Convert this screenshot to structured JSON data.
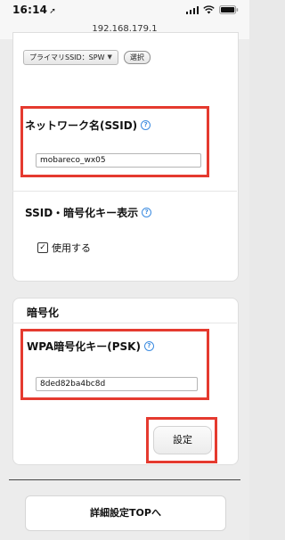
{
  "status_bar": {
    "time": "16:14",
    "location_glyph": "➚",
    "icons": [
      "signal-icon",
      "wifi-icon",
      "battery-icon"
    ]
  },
  "browser": {
    "url": "192.168.179.1"
  },
  "ssid_select": {
    "selected": "プライマリSSID：SPW",
    "select_button": "選択"
  },
  "network_name": {
    "label": "ネットワーク名(SSID)",
    "value": "mobareco_wx05"
  },
  "ssid_key_display": {
    "label": "SSID・暗号化キー表示",
    "checkbox_label": "使用する",
    "checked": true
  },
  "encryption": {
    "section_title": "暗号化",
    "psk_label": "WPA暗号化キー(PSK)",
    "psk_value": "8ded82ba4bc8d"
  },
  "actions": {
    "set_label": "設定",
    "top_link_label": "詳細設定TOPへ"
  },
  "colors": {
    "highlight": "#e53a2f",
    "help_icon": "#3b8be0"
  }
}
